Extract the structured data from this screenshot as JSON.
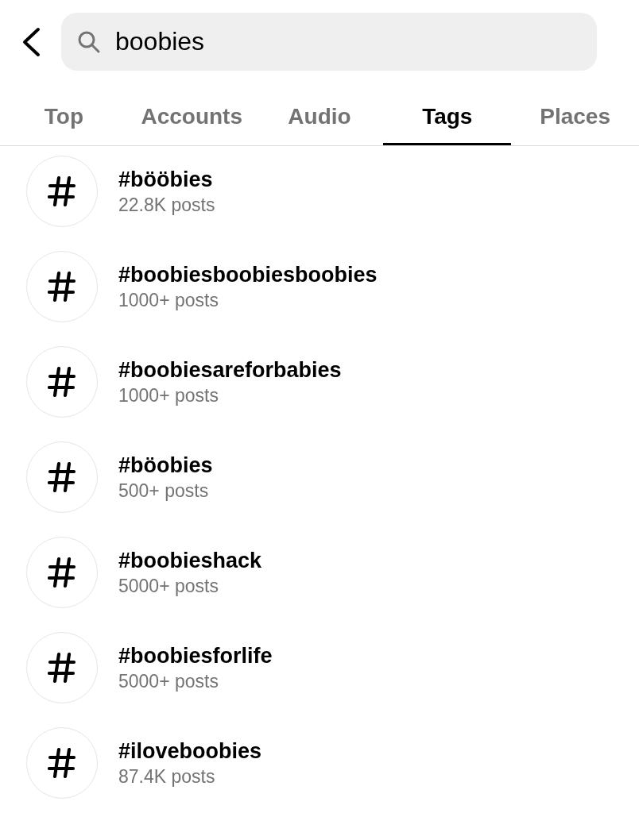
{
  "search": {
    "value": "boobies"
  },
  "tabs": [
    {
      "label": "Top",
      "selected": false
    },
    {
      "label": "Accounts",
      "selected": false
    },
    {
      "label": "Audio",
      "selected": false
    },
    {
      "label": "Tags",
      "selected": true
    },
    {
      "label": "Places",
      "selected": false
    }
  ],
  "results": [
    {
      "tag": "#bööbies",
      "count": "22.8K posts"
    },
    {
      "tag": "#boobiesboobiesboobies",
      "count": "1000+ posts"
    },
    {
      "tag": "#boobiesareforbabies",
      "count": "1000+ posts"
    },
    {
      "tag": "#böobies",
      "count": "500+ posts"
    },
    {
      "tag": "#boobieshack",
      "count": "5000+ posts"
    },
    {
      "tag": "#boobiesforlife",
      "count": "5000+ posts"
    },
    {
      "tag": "#iloveboobies",
      "count": "87.4K posts"
    }
  ]
}
